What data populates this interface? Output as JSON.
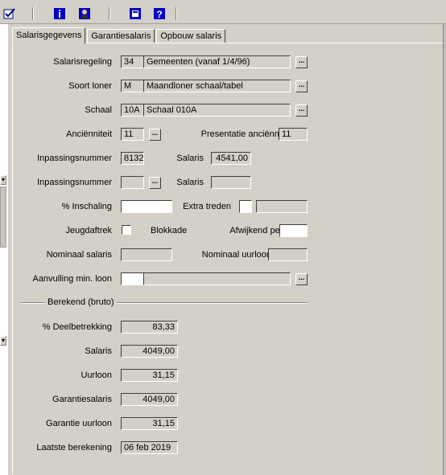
{
  "toolbar": {
    "icons": [
      "check-icon",
      "info-icon",
      "person-icon",
      "calculator-icon",
      "help-icon"
    ]
  },
  "tabs": [
    {
      "label": "Salarisgegevens",
      "active": true
    },
    {
      "label": "Garantiesalaris",
      "active": false
    },
    {
      "label": "Opbouw salaris",
      "active": false
    }
  ],
  "form": {
    "salarisregeling": {
      "label": "Salarisregeling",
      "code": "34",
      "desc": "Gemeenten (vanaf 1/4/96)"
    },
    "soort_loner": {
      "label": "Soort loner",
      "code": "M",
      "desc": "Maandloner schaal/tabel"
    },
    "schaal": {
      "label": "Schaal",
      "code": "10A",
      "desc": "Schaal 010A"
    },
    "ancienniteit": {
      "label": "Anciënniteit",
      "value": "11"
    },
    "presentatie_ancienniteit": {
      "label": "Presentatie anciënniteit",
      "value": "11"
    },
    "inpassingsnummer1": {
      "label": "Inpassingsnummer",
      "value": "8132"
    },
    "salaris1": {
      "label": "Salaris",
      "value": "4541,00"
    },
    "inpassingsnummer2": {
      "label": "Inpassingsnummer",
      "value": ""
    },
    "salaris2": {
      "label": "Salaris",
      "value": ""
    },
    "inschaling": {
      "label": "% Inschaling",
      "value": ""
    },
    "extra_treden": {
      "label": "Extra treden",
      "value": ""
    },
    "jeugdaftrek": {
      "label": "Jeugdaftrek"
    },
    "blokkade": {
      "label": "Blokkade"
    },
    "afwijkend": {
      "label": "Afwijkend perct.",
      "value": ""
    },
    "nominaal_salaris": {
      "label": "Nominaal salaris",
      "value": ""
    },
    "nominaal_uurloon": {
      "label": "Nominaal uurloon",
      "value": ""
    },
    "aanvulling": {
      "label": "Aanvulling min. loon",
      "code": "",
      "desc": ""
    }
  },
  "berekend": {
    "title": "Berekend (bruto)",
    "deelbetrekking": {
      "label": "% Deelbetrekking",
      "value": "83,33"
    },
    "salaris": {
      "label": "Salaris",
      "value": "4049,00"
    },
    "uurloon": {
      "label": "Uurloon",
      "value": "31,15"
    },
    "garantiesalaris": {
      "label": "Garantiesalaris",
      "value": "4049,00"
    },
    "garantie_uurloon": {
      "label": "Garantie uurloon",
      "value": "31,15"
    },
    "laatste_berekening": {
      "label": "Laatste berekening",
      "value": "06 feb 2019"
    }
  },
  "dots_label": "...",
  "colors": {
    "face": "#d4d0c8",
    "shadow": "#404040",
    "highlight": "#ffffff"
  }
}
